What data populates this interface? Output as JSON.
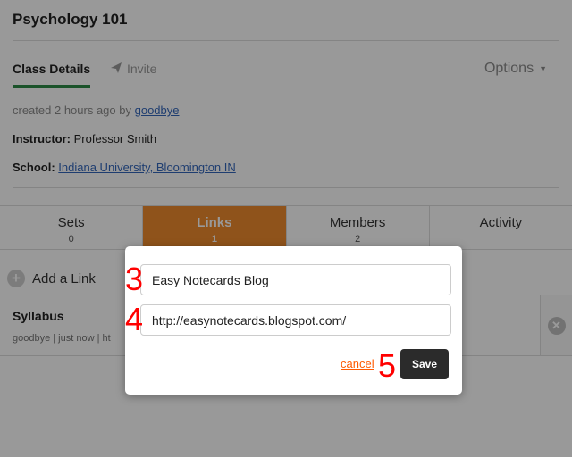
{
  "class": {
    "title": "Psychology 101"
  },
  "tabs": {
    "details": "Class Details",
    "invite": "Invite",
    "options": "Options"
  },
  "meta": {
    "created_prefix": "created 2 hours ago by",
    "created_user": "goodbye",
    "instructor_label": "Instructor:",
    "instructor_value": "Professor Smith",
    "school_label": "School:",
    "school_value": "Indiana University, Bloomington IN"
  },
  "section_tabs": [
    {
      "label": "Sets",
      "count": "0"
    },
    {
      "label": "Links",
      "count": "1"
    },
    {
      "label": "Members",
      "count": "2"
    },
    {
      "label": "Activity",
      "count": ""
    }
  ],
  "add_link_label": "Add a Link",
  "links_list": [
    {
      "title": "Syllabus",
      "meta": "goodbye  |  just now  |  ht"
    }
  ],
  "modal": {
    "title_value": "Easy Notecards Blog",
    "url_value": "http://easynotecards.blogspot.com/",
    "cancel_label": "cancel",
    "save_label": "Save"
  },
  "annotations": {
    "n3": "3",
    "n4": "4",
    "n5": "5"
  },
  "colors": {
    "active_tab": "#ee8a2e",
    "underline": "#2e8b46",
    "link": "#3366bb",
    "annotation": "#ff0000",
    "cancel": "#ff5a00"
  },
  "icons": {
    "invite": "paper-plane-icon",
    "options": "caret-down-icon",
    "add": "plus-circle-icon",
    "remove": "close-circle-icon"
  }
}
